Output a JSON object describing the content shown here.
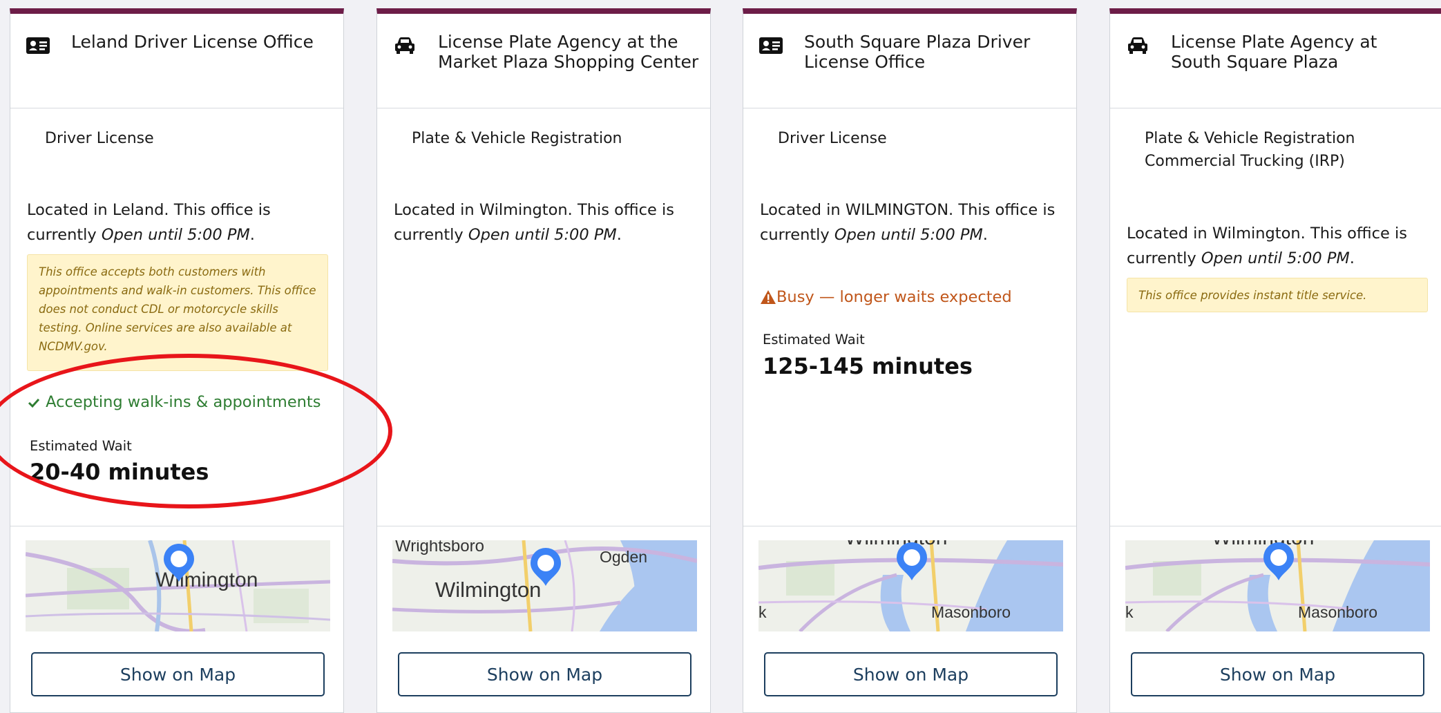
{
  "offices": [
    {
      "icon": "id-card-icon",
      "title": "Leland Driver License Office",
      "services": [
        "Driver License"
      ],
      "location_prefix": "Located in Leland. This office is currently ",
      "hours": "Open until 5:00 PM",
      "hours_suffix": ".",
      "note": "This office accepts both customers with appointments and walk-in customers. This office does not conduct CDL or motorcycle skills testing. Online services are also available at NCDMV.gov.",
      "status": "Accepting walk-ins & appointments",
      "wait_label": "Estimated Wait",
      "wait_value": "20-40 minutes",
      "map_labels": [
        "Wilmington"
      ],
      "button": "Show on Map"
    },
    {
      "icon": "car-icon",
      "title": "License Plate Agency at the Market Plaza Shopping Center",
      "services": [
        "Plate & Vehicle Registration"
      ],
      "location_prefix": "Located in Wilmington. This office is currently ",
      "hours": "Open until 5:00 PM",
      "hours_suffix": ".",
      "map_labels": [
        "Wilmington",
        "Ogden",
        "Wrightsboro"
      ],
      "button": "Show on Map"
    },
    {
      "icon": "id-card-icon",
      "title": "South Square Plaza Driver License Office",
      "services": [
        "Driver License"
      ],
      "location_prefix": "Located in WILMINGTON. This office is currently ",
      "hours": "Open until 5:00 PM",
      "hours_suffix": ".",
      "status": "Busy — longer waits expected",
      "wait_label": "Estimated Wait",
      "wait_value": "125-145 minutes",
      "map_labels": [
        "Masonboro",
        "Wilmington",
        "k"
      ],
      "button": "Show on Map"
    },
    {
      "icon": "car-icon",
      "title": "License Plate Agency at South Square Plaza",
      "services": [
        "Plate & Vehicle Registration",
        "Commercial Trucking (IRP)"
      ],
      "location_prefix": "Located in Wilmington. This office is currently ",
      "hours": "Open until 5:00 PM",
      "hours_suffix": ".",
      "note": "This office provides instant title service.",
      "map_labels": [
        "Masonboro",
        "Wilmington",
        "k"
      ],
      "button": "Show on Map"
    }
  ],
  "colors": {
    "card_top_border": "#6d1d48",
    "status_ok": "#2e7d32",
    "status_busy": "#c0561a",
    "note_bg": "#fff4cc",
    "button_border": "#1c3e5e",
    "highlight": "#e8151a"
  }
}
